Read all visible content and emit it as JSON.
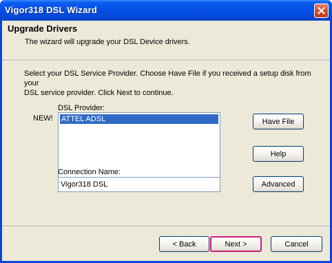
{
  "window": {
    "title": "Vigor318 DSL Wizard"
  },
  "header": {
    "title": "Upgrade Drivers",
    "subtitle": "The wizard will upgrade your DSL Device drivers."
  },
  "instruction": {
    "line1": "Select your DSL Service Provider.  Choose Have File if you received a setup disk from your",
    "line2": "DSL service provider.  Click Next to continue."
  },
  "provider": {
    "label": "DSL Provider:",
    "new_marker": "NEW!",
    "items": [
      "ATTEL ADSL"
    ],
    "selected_index": 0
  },
  "connection": {
    "label": "Connection Name:",
    "value": "Vigor318 DSL"
  },
  "side_buttons": {
    "have_file": "Have File",
    "help": "Help",
    "advanced": "Advanced"
  },
  "nav_buttons": {
    "back": "< Back",
    "next": "Next >",
    "cancel": "Cancel"
  },
  "colors": {
    "titlebar": "#0551e8",
    "dialog_bg": "#ece9d8",
    "selection": "#316ac5",
    "focus_highlight": "#cc1f7d"
  },
  "icons": {
    "close": "close-x-icon"
  }
}
